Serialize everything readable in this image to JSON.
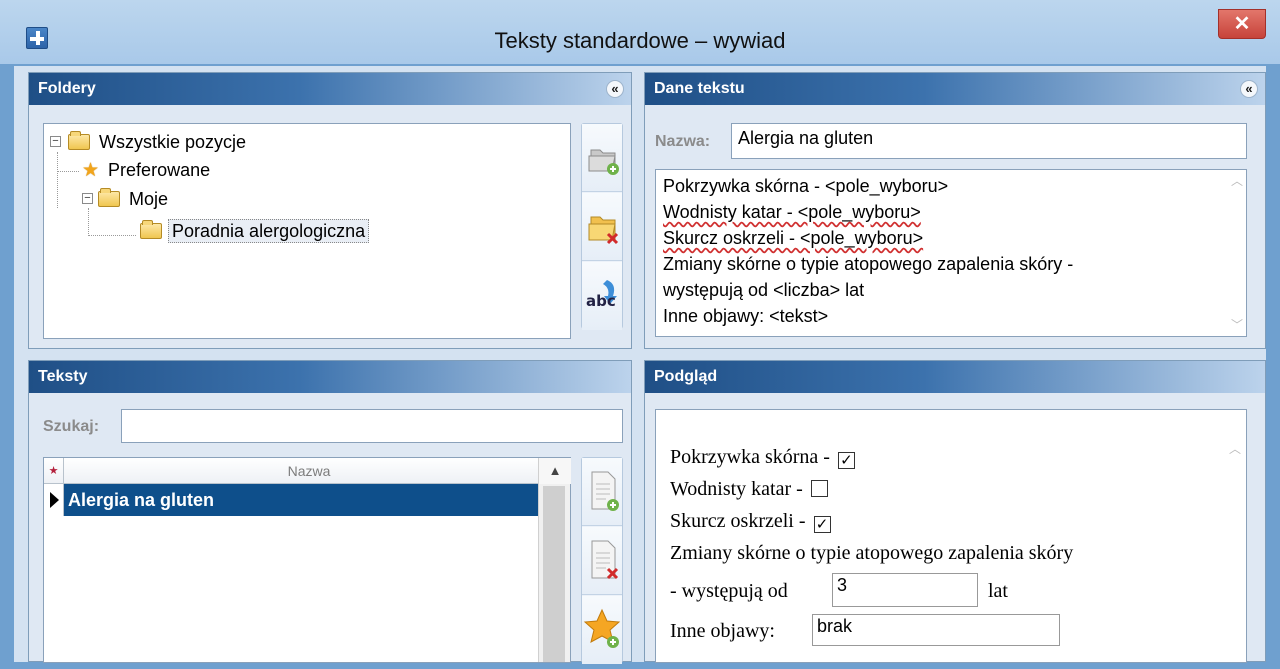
{
  "window": {
    "title": "Teksty standardowe – wywiad",
    "close_glyph": "✕",
    "app_icon": "plus-icon"
  },
  "folders_panel": {
    "title": "Foldery",
    "collapse_glyph": "«",
    "tree": [
      {
        "label": "Wszystkie pozycje",
        "icon": "folder-icon",
        "expander": "−"
      },
      {
        "label": "Preferowane",
        "icon": "star-icon"
      },
      {
        "label": "Moje",
        "icon": "folder-icon",
        "expander": "−"
      },
      {
        "label": "Poradnia alergologiczna",
        "icon": "folder-icon",
        "selected": true
      }
    ],
    "buttons": [
      "add-folder-icon",
      "delete-folder-icon",
      "rename-abc-icon"
    ]
  },
  "text_data_panel": {
    "title": "Dane tekstu",
    "name_label": "Nazwa:",
    "name_value": "Alergia na gluten",
    "body_lines": [
      "Pokrzywka skórna - <pole_wyboru>",
      "Wodnisty katar - <pole_wyboru>",
      "Skurcz oskrzeli - <pole_wyboru>",
      "Zmiany skórne o typie atopowego zapalenia skóry -",
      "występują od <liczba> lat",
      "Inne objawy: <tekst>"
    ]
  },
  "texts_panel": {
    "title": "Teksty",
    "search_label": "Szukaj:",
    "search_value": "",
    "grid_header_star": "★",
    "grid_header_name": "Nazwa",
    "rows": [
      {
        "name": "Alergia na gluten",
        "selected": true
      }
    ],
    "buttons": [
      "add-text-icon",
      "delete-text-icon",
      "add-favorite-icon"
    ]
  },
  "preview_panel": {
    "title": "Podgląd",
    "lines": {
      "l1": "Pokrzywka skórna -",
      "l2": "Wodnisty katar -",
      "l3": "Skurcz oskrzeli -",
      "l4": "Zmiany skórne o typie atopowego zapalenia skóry",
      "l5a": "- występują od",
      "l5b": "lat",
      "l6": "Inne objawy:"
    },
    "checkboxes": {
      "pokrzywka": true,
      "katar": false,
      "skurcz": true
    },
    "check_glyph": "✓",
    "years_value": "3",
    "other_value": "brak"
  }
}
